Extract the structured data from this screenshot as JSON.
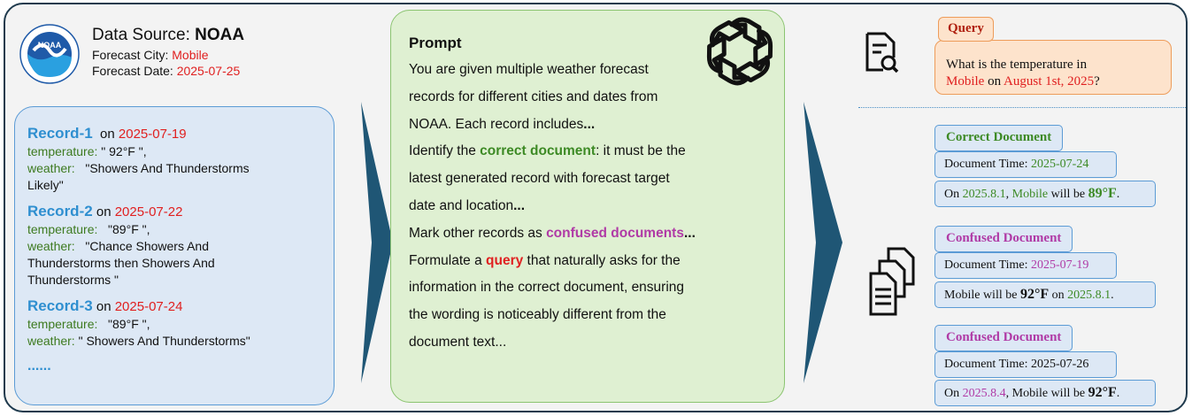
{
  "source": {
    "title_prefix": "Data Source: ",
    "title_name": "NOAA",
    "logo_text": "NOAA",
    "city_label": "Forecast City: ",
    "city": "Mobile",
    "date_label": "Forecast Date: ",
    "date": "2025-07-25"
  },
  "records": [
    {
      "name": "Record-1",
      "on": "on",
      "date": "2025-07-19",
      "temp_label": "temperature:",
      "temp": "\" 92°F \",",
      "weather_label": "weather:",
      "weather_1": "\"Showers And Thunderstorms",
      "weather_2": "Likely\"",
      "weather_3": ""
    },
    {
      "name": "Record-2",
      "on": "on",
      "date": "2025-07-22",
      "temp_label": "temperature:",
      "temp": "\"89°F \",",
      "weather_label": "weather:",
      "weather_1": "\"Chance Showers And",
      "weather_2": "Thunderstorms then Showers And",
      "weather_3": "Thunderstorms \""
    },
    {
      "name": "Record-3",
      "on": "on",
      "date": "2025-07-24",
      "temp_label": "temperature:",
      "temp": "\"89°F \",",
      "weather_label": "weather:",
      "weather_1": "\" Showers And Thunderstorms\"",
      "weather_2": "",
      "weather_3": ""
    }
  ],
  "records_more": "......",
  "prompt": {
    "title": "Prompt",
    "l1": "You are given multiple weather forecast",
    "l2": " records for different cities and dates from",
    "l3a": "NOAA. Each record includes",
    "l3b": "...",
    "l4a": "Identify the ",
    "l4b": "correct document",
    "l4c": ": it must be the",
    "l5": "latest generated record with forecast target",
    "l6a": "date and location",
    "l6b": "...",
    "l7a": "Mark other records as ",
    "l7b": "confused documents",
    "l7c": "...",
    "l8a": "Formulate a ",
    "l8b": "query",
    "l8c": " that naturally asks for the",
    "l9": "information in the correct document, ensuring",
    "l10": "the wording is noticeably different from the",
    "l11": "document text..."
  },
  "query": {
    "tag": "Query",
    "t1": "What is the temperature in",
    "city": "Mobile",
    "t2": " on ",
    "date": "August 1st, 2025",
    "t3": "?"
  },
  "correct_doc": {
    "tag": "Correct Document",
    "time_label": "Document Time: ",
    "time": "2025-07-24",
    "c1": "On ",
    "c_date": "2025.8.1",
    "c2": ", ",
    "c_city": "Mobile",
    "c3": " will be ",
    "c_temp": "89°F",
    "c4": "."
  },
  "confused_doc_1": {
    "tag": "Confused Document",
    "time_label": "Document Time: ",
    "time": "2025-07-19",
    "c1": "Mobile will be ",
    "c_temp": "92°F",
    "c2": "  on ",
    "c_date": "2025.8.1",
    "c3": "."
  },
  "confused_doc_2": {
    "tag": "Confused Document",
    "time_label": "Document Time: ",
    "time": "2025-07-26",
    "c1": "On ",
    "c_date": "2025.8.4",
    "c2": ", Mobile will be ",
    "c_temp": "92°F",
    "c3": "."
  },
  "colors": {
    "frame": "#1f3a4d",
    "arrow": "#1f5675",
    "record_name": "#2f8fd0",
    "red": "#e02020",
    "green": "#3d8a25",
    "purple": "#b03aa6"
  },
  "icons": {
    "source_logo": "noaa-logo",
    "prompt_logo": "openai-logo",
    "query_icon": "document-search-icon",
    "docs_icon": "documents-stack-icon",
    "arrow": "chevron-arrow-right"
  }
}
